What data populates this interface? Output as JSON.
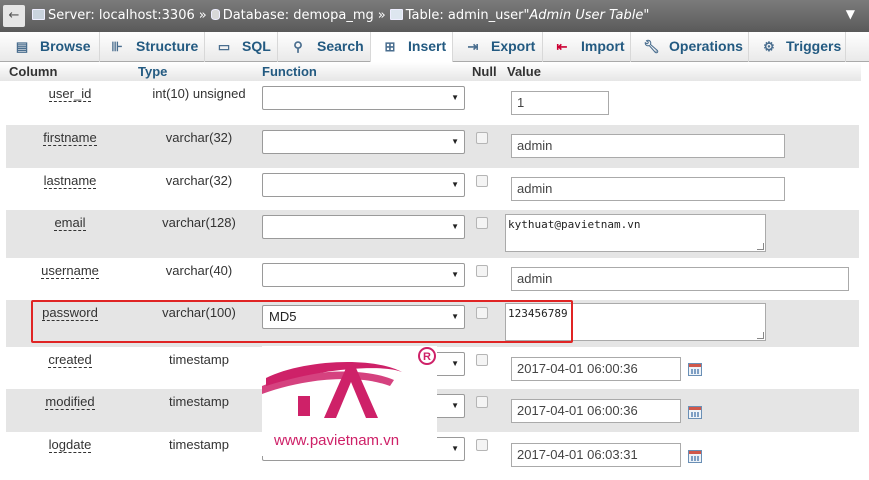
{
  "breadcrumb": {
    "server": "Server: localhost:3306",
    "database": "Database: demopa_mg",
    "table": "Table: admin_user",
    "comment": "\"Admin User Table\"",
    "separator": "»"
  },
  "tabs": [
    {
      "label": "Browse",
      "icon": "browse-icon"
    },
    {
      "label": "Structure",
      "icon": "structure-icon"
    },
    {
      "label": "SQL",
      "icon": "sql-icon"
    },
    {
      "label": "Search",
      "icon": "search-icon"
    },
    {
      "label": "Insert",
      "icon": "insert-icon",
      "active": true
    },
    {
      "label": "Export",
      "icon": "export-icon"
    },
    {
      "label": "Import",
      "icon": "import-icon"
    },
    {
      "label": "Operations",
      "icon": "operations-icon"
    },
    {
      "label": "Triggers",
      "icon": "triggers-icon"
    }
  ],
  "table": {
    "headers": {
      "column": "Column",
      "type": "Type",
      "function": "Function",
      "null": "Null",
      "value": "Value"
    },
    "rows": [
      {
        "column": "user_id",
        "type": "int(10) unsigned",
        "function": "",
        "value": "1"
      },
      {
        "column": "firstname",
        "type": "varchar(32)",
        "function": "",
        "value": "admin"
      },
      {
        "column": "lastname",
        "type": "varchar(32)",
        "function": "",
        "value": "admin"
      },
      {
        "column": "email",
        "type": "varchar(128)",
        "function": "",
        "value": "kythuat@pavietnam.vn"
      },
      {
        "column": "username",
        "type": "varchar(40)",
        "function": "",
        "value": "admin"
      },
      {
        "column": "password",
        "type": "varchar(100)",
        "function": "MD5",
        "value": "123456789"
      },
      {
        "column": "created",
        "type": "timestamp",
        "function": "",
        "value": "2017-04-01 06:00:36"
      },
      {
        "column": "modified",
        "type": "timestamp",
        "function": "",
        "value": "2017-04-01 06:00:36"
      },
      {
        "column": "logdate",
        "type": "timestamp",
        "function": "",
        "value": "2017-04-01 06:03:31"
      }
    ]
  },
  "watermark": {
    "url": "www.pavietnam.vn",
    "mark": "®"
  },
  "colors": {
    "accent": "#235a81",
    "highlight": "#e02424",
    "brand": "#ce2168"
  }
}
